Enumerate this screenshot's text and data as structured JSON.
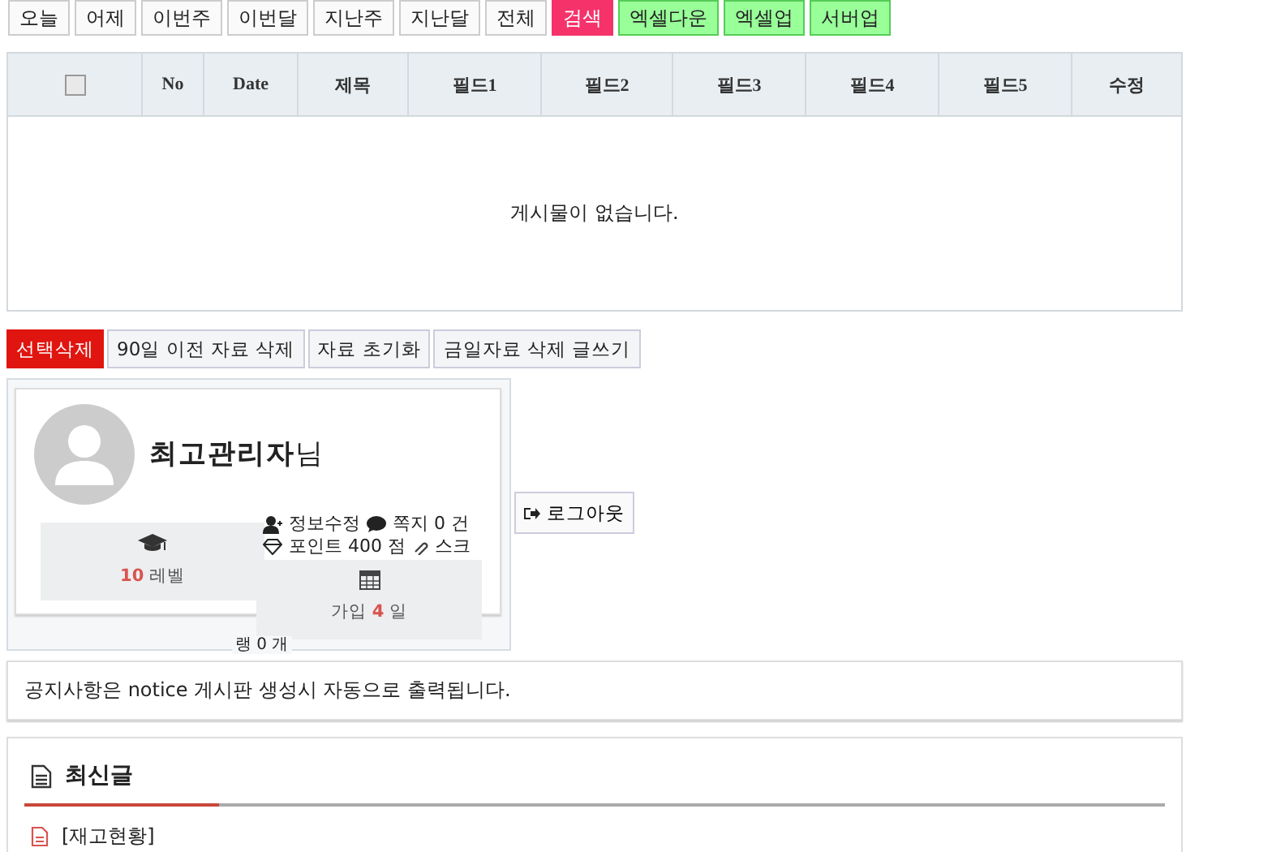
{
  "filter_buttons": [
    {
      "label": "오늘",
      "kind": "plain"
    },
    {
      "label": "어제",
      "kind": "plain"
    },
    {
      "label": "이번주",
      "kind": "plain"
    },
    {
      "label": "이번달",
      "kind": "plain"
    },
    {
      "label": "지난주",
      "kind": "plain"
    },
    {
      "label": "지난달",
      "kind": "plain"
    },
    {
      "label": "전체",
      "kind": "plain"
    },
    {
      "label": "검색",
      "kind": "search"
    },
    {
      "label": "엑셀다운",
      "kind": "excel"
    },
    {
      "label": "엑셀업",
      "kind": "excel"
    },
    {
      "label": "서버업",
      "kind": "excel"
    }
  ],
  "table": {
    "select_all_checked": false,
    "columns": [
      "No",
      "Date",
      "제목",
      "필드1",
      "필드2",
      "필드3",
      "필드4",
      "필드5",
      "수정"
    ],
    "empty_message": "게시물이 없습니다."
  },
  "action_buttons": [
    {
      "label": "선택삭제",
      "kind": "danger"
    },
    {
      "label": "90일 이전 자료 삭제",
      "kind": "plain"
    },
    {
      "label": "자료 초기화",
      "kind": "plain"
    },
    {
      "label": "금일자료 삭제 글쓰기",
      "kind": "plain"
    }
  ],
  "profile": {
    "name": "최고관리자",
    "suffix": "님",
    "level_value": "10",
    "level_label": "레벨",
    "edit_info": "정보수정",
    "messages": "쪽지 0 건",
    "points": "포인트 400 점",
    "scrap": "스크",
    "join_prefix": "가입",
    "join_value": "4",
    "join_suffix": "일",
    "rank": "랭 0 개",
    "logout": "로그아웃"
  },
  "notice": "공지사항은 notice 게시판 생성시 자동으로 출력됩니다.",
  "latest": {
    "title": "최신글",
    "items": [
      "[재고현황]"
    ]
  }
}
